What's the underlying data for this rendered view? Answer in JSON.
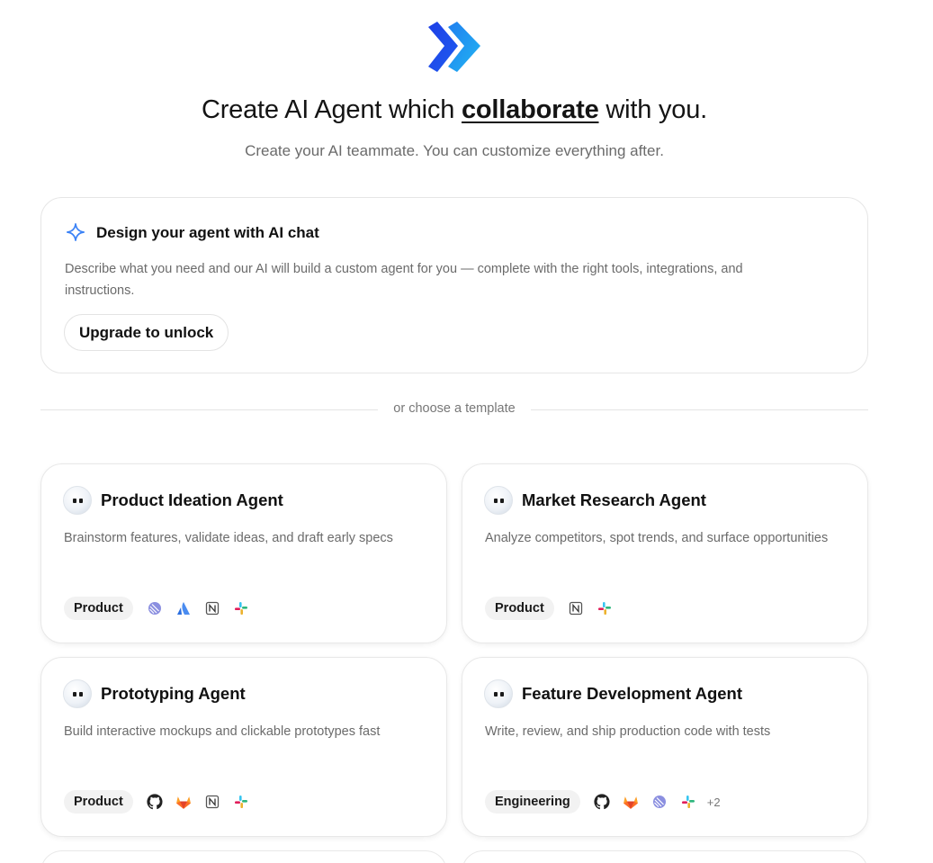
{
  "header": {
    "logo": "double-chevron-logo",
    "headline_before": "Create AI Agent which ",
    "headline_emphasis": "collaborate",
    "headline_after": " with you.",
    "subheadline": "Create your AI teammate. You can customize everything after."
  },
  "ai_design": {
    "icon": "sparkle-icon",
    "title": "Design your agent with AI chat",
    "description": "Describe what you need and our AI will build a custom agent for you — complete with the right tools, integrations, and instructions.",
    "button_label": "Upgrade to unlock"
  },
  "divider_text": "or choose a template",
  "templates": [
    {
      "name": "Product Ideation Agent",
      "description": "Brainstorm features, validate ideas, and draft early specs",
      "tag": "Product",
      "integrations": [
        "linear-icon",
        "atlassian-icon",
        "notion-icon",
        "slack-icon"
      ]
    },
    {
      "name": "Market Research Agent",
      "description": "Analyze competitors, spot trends, and surface opportunities",
      "tag": "Product",
      "integrations": [
        "notion-icon",
        "slack-icon"
      ]
    },
    {
      "name": "Prototyping Agent",
      "description": "Build interactive mockups and clickable prototypes fast",
      "tag": "Product",
      "integrations": [
        "github-icon",
        "gitlab-icon",
        "notion-icon",
        "slack-icon"
      ]
    },
    {
      "name": "Feature Development Agent",
      "description": "Write, review, and ship production code with tests",
      "tag": "Engineering",
      "integrations": [
        "github-icon",
        "gitlab-icon",
        "linear-icon",
        "slack-icon"
      ],
      "more": "+2"
    }
  ],
  "colors": {
    "logo_dark": "#1d3fe6",
    "logo_light": "#1fa2f0",
    "sparkle": "#3b82f6",
    "muted_text": "#6b6b6b"
  }
}
